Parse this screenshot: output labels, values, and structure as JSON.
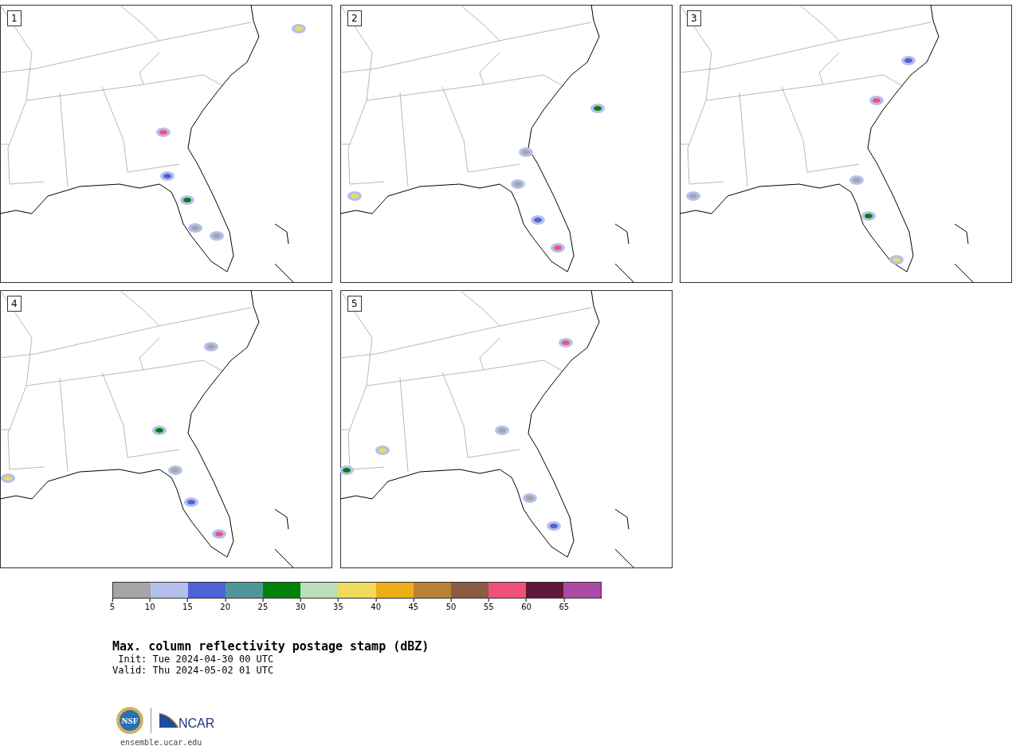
{
  "panels": [
    {
      "label": "1"
    },
    {
      "label": "2"
    },
    {
      "label": "3"
    },
    {
      "label": "4"
    },
    {
      "label": "5"
    }
  ],
  "colorbar": {
    "bins": [
      {
        "color": "#a5a5a5",
        "tick": "5"
      },
      {
        "color": "#b4bfec",
        "tick": "10"
      },
      {
        "color": "#5060d6",
        "tick": "15"
      },
      {
        "color": "#4f969a",
        "tick": "20"
      },
      {
        "color": "#00820a",
        "tick": "25"
      },
      {
        "color": "#bcdcbc",
        "tick": "30"
      },
      {
        "color": "#efda5c",
        "tick": "35"
      },
      {
        "color": "#efae18",
        "tick": "40"
      },
      {
        "color": "#b98232",
        "tick": "45"
      },
      {
        "color": "#8a5c42",
        "tick": "50"
      },
      {
        "color": "#f2507c",
        "tick": "55"
      },
      {
        "color": "#5f1837",
        "tick": "60"
      },
      {
        "color": "#ac4aa6",
        "tick": "65"
      }
    ]
  },
  "title": "Max. column reflectivity postage stamp (dBZ)",
  "init": " Init: Tue 2024-04-30 00 UTC",
  "valid": "Valid: Thu 2024-05-02 01 UTC",
  "logos": {
    "nsf": "NSF",
    "ncar": "NCAR"
  },
  "url": "ensemble.ucar.edu"
}
